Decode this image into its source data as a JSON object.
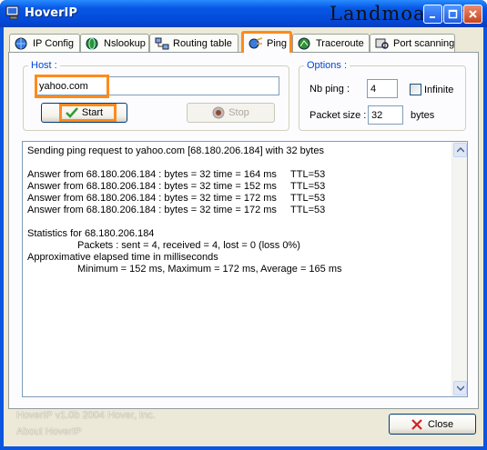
{
  "window": {
    "title": "HoverIP",
    "watermark": "Landmoa.net"
  },
  "tabs": [
    {
      "label": "IP Config",
      "icon": "ip-config-icon",
      "active": false
    },
    {
      "label": "Nslookup",
      "icon": "globe-icon",
      "active": false
    },
    {
      "label": "Routing table",
      "icon": "network-icon",
      "active": false
    },
    {
      "label": "Ping",
      "icon": "ping-icon",
      "active": true
    },
    {
      "label": "Traceroute",
      "icon": "traceroute-icon",
      "active": false
    },
    {
      "label": "Port scanning",
      "icon": "port-scan-icon",
      "active": false
    }
  ],
  "host": {
    "group_label": "Host :",
    "value": "yahoo.com",
    "start_label": "Start",
    "stop_label": "Stop"
  },
  "options": {
    "group_label": "Options :",
    "nb_ping_label": "Nb ping :",
    "nb_ping_value": "4",
    "infinite_label": "Infinite",
    "infinite_checked": false,
    "packet_size_label": "Packet size :",
    "packet_size_value": "32",
    "bytes_label": "bytes"
  },
  "output": {
    "lines": [
      "Sending ping request to yahoo.com [68.180.206.184] with 32 bytes",
      "",
      "Answer from 68.180.206.184 : bytes = 32 time = 164 ms     TTL=53",
      "Answer from 68.180.206.184 : bytes = 32 time = 152 ms     TTL=53",
      "Answer from 68.180.206.184 : bytes = 32 time = 172 ms     TTL=53",
      "Answer from 68.180.206.184 : bytes = 32 time = 172 ms     TTL=53",
      "",
      "Statistics for 68.180.206.184",
      "                  Packets : sent = 4, received = 4, lost = 0 (loss 0%)",
      "Approximative elapsed time in milliseconds",
      "                  Minimum = 152 ms, Maximum = 172 ms, Average = 165 ms"
    ]
  },
  "footer": {
    "version": "HoverIP v1.0b 2004 Hover, Inc.",
    "about": "About HoverIP",
    "close_label": "Close"
  }
}
